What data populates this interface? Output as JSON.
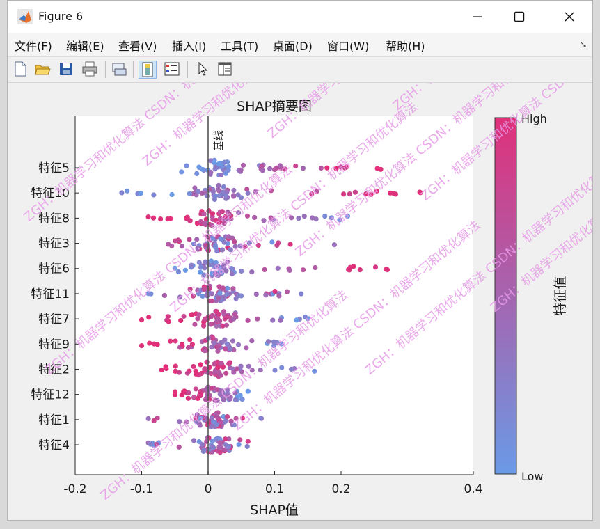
{
  "window": {
    "title": "Figure 6",
    "menus": [
      "文件(F)",
      "编辑(E)",
      "查看(V)",
      "插入(I)",
      "工具(T)",
      "桌面(D)",
      "窗口(W)",
      "帮助(H)"
    ],
    "menu_overflow": "↘",
    "toolbar_icons": [
      "new-figure-icon",
      "open-file-icon",
      "save-icon",
      "print-icon",
      "link-plot-icon",
      "insert-colorbar-icon",
      "insert-legend-icon",
      "pointer-icon",
      "property-inspector-icon"
    ]
  },
  "chart_data": {
    "type": "scatter",
    "title": "SHAP摘要图",
    "xlabel": "SHAP值",
    "ylabel": "",
    "xlim": [
      -0.2,
      0.4
    ],
    "xticks": [
      -0.2,
      -0.1,
      0,
      0.1,
      0.2,
      0.4
    ],
    "xtick_labels": [
      "-0.2",
      "-0.1",
      "0",
      "0.1",
      "0.2",
      "0.4"
    ],
    "baseline": {
      "x": 0,
      "label": "基线"
    },
    "features": [
      "特征5",
      "特征10",
      "特征8",
      "特征3",
      "特征6",
      "特征11",
      "特征7",
      "特征9",
      "特征2",
      "特征12",
      "特征1",
      "特征4"
    ],
    "ranges": [
      {
        "min": -0.04,
        "max": 0.26,
        "hi_side": "right"
      },
      {
        "min": -0.13,
        "max": 0.32,
        "hi_side": "right"
      },
      {
        "min": -0.09,
        "max": 0.21,
        "hi_side": "left"
      },
      {
        "min": -0.06,
        "max": 0.19,
        "hi_side": "center"
      },
      {
        "min": -0.05,
        "max": 0.27,
        "hi_side": "right"
      },
      {
        "min": -0.09,
        "max": 0.14,
        "hi_side": "center"
      },
      {
        "min": -0.1,
        "max": 0.15,
        "hi_side": "left"
      },
      {
        "min": -0.1,
        "max": 0.11,
        "hi_side": "left"
      },
      {
        "min": -0.07,
        "max": 0.16,
        "hi_side": "left"
      },
      {
        "min": -0.05,
        "max": 0.06,
        "hi_side": "left"
      },
      {
        "min": -0.09,
        "max": 0.08,
        "hi_side": "center"
      },
      {
        "min": -0.09,
        "max": 0.06,
        "hi_side": "center"
      }
    ],
    "points_per_feature": 60,
    "colorbar": {
      "label": "特征值",
      "high": "High",
      "low": "Low",
      "color_high": "#e0307a",
      "color_low": "#6a9ae6"
    },
    "axis_color": "#262626"
  },
  "watermark": {
    "text": "ZGH：机器学习和优化算法  CSDN：机器学习和优化算法",
    "color": "#e59ae6"
  }
}
